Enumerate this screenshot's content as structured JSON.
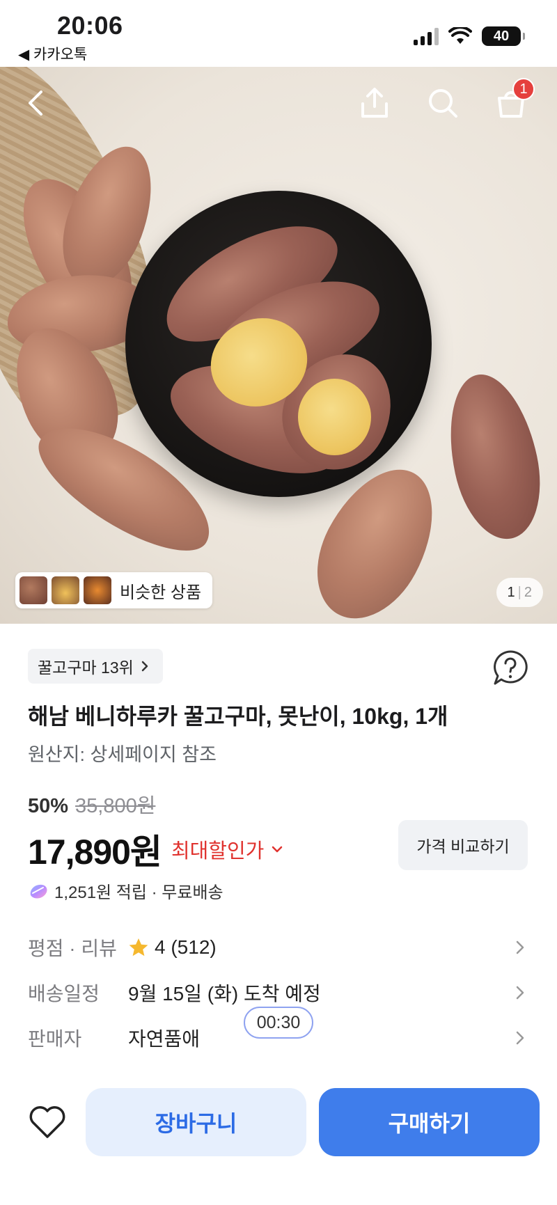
{
  "status_bar": {
    "time": "20:06",
    "back_app": "◀ 카카오톡",
    "battery": "40"
  },
  "hero": {
    "cart_badge": "1",
    "similar_label": "비슷한 상품",
    "pager_current": "1",
    "pager_total": "2"
  },
  "product": {
    "rank_chip": "꿀고구마 13위",
    "title": "해남 베니하루카 꿀고구마, 못난이, 10kg, 1개",
    "origin": "원산지: 상세페이지 참조",
    "discount_percent": "50%",
    "original_price": "35,800원",
    "price": "17,890원",
    "max_discount_label": "최대할인가",
    "compare_button": "가격 비교하기",
    "reward_text": "1,251원 적립 · 무료배송"
  },
  "info_rows": {
    "rating_label": "평점 · 리뷰",
    "rating_value": "4 (512)",
    "delivery_label": "배송일정",
    "delivery_value": "9월 15일 (화) 도착 예정",
    "seller_label": "판매자",
    "seller_value": "자연품애"
  },
  "timer": "00:30",
  "bottom_bar": {
    "cart_label": "장바구니",
    "buy_label": "구매하기"
  },
  "colors": {
    "accent_blue": "#3f7deb",
    "cart_button_bg": "#e6effd",
    "discount_red": "#e0322e",
    "badge_red": "#e5403d",
    "star": "#f5b82e"
  },
  "icons": [
    "back-arrow-icon",
    "share-icon",
    "search-icon",
    "cart-icon",
    "chevron-right-icon",
    "help-icon",
    "chevron-down-icon",
    "reward-icon",
    "star-icon",
    "heart-icon",
    "signal-icon",
    "wifi-icon",
    "battery-icon"
  ]
}
